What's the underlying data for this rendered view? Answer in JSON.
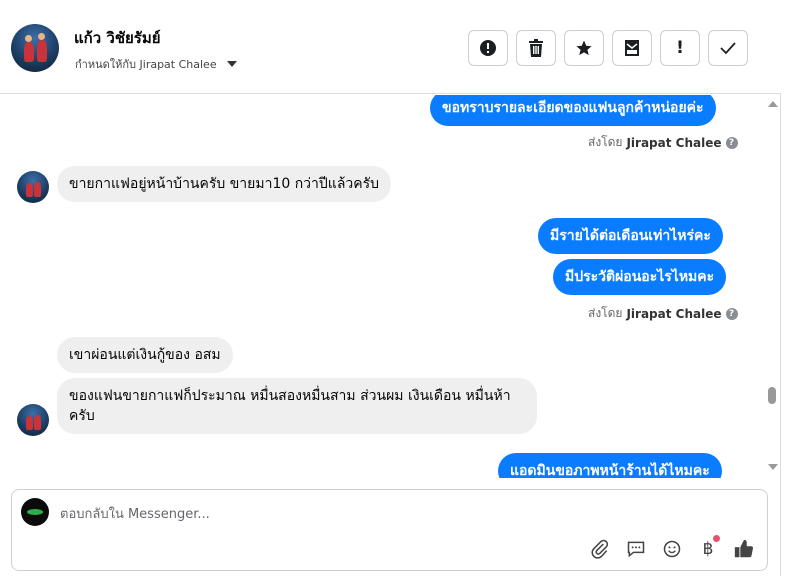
{
  "header": {
    "contact_name": "แก้ว วิชัยรัมย์",
    "assigned_to": "กำหนดให้กับ Jirapat Chalee"
  },
  "toolbar": {
    "buttons": [
      {
        "icon": "alert-circle-icon",
        "glyph": "❗"
      },
      {
        "icon": "trash-icon",
        "glyph": "🗑"
      },
      {
        "icon": "star-icon",
        "glyph": "★"
      },
      {
        "icon": "mark-unread-icon",
        "glyph": "✉"
      },
      {
        "icon": "exclamation-icon",
        "glyph": "!"
      },
      {
        "icon": "check-icon",
        "glyph": "✓"
      }
    ]
  },
  "messages": {
    "m1": "ขอทราบรายละเอียดของแฟนลูกค้าหน่อยค่ะ",
    "sent1_prefix": "ส่งโดย",
    "sent1_name": "Jirapat Chalee",
    "m2": "ขายกาแฟอยู่หน้าบ้านครับ  ขายมา10 กว่าปีแล้วครับ",
    "m3": "มีรายได้ต่อเดือนเท่าไหร่คะ",
    "m4": "มีประวัติผ่อนอะไรไหมคะ",
    "sent2_prefix": "ส่งโดย",
    "sent2_name": "Jirapat Chalee",
    "m5": "เขาผ่อนแต่เงินกู้ของ  อสม",
    "m6": "ของแฟนขายกาแฟก็ประมาณ หมื่นสองหมื่นสาม   ส่วนผม เงินเดือน หมื่นห้าครับ",
    "m7": "แอดมินขอภาพหน้าร้านได้ไหมคะ"
  },
  "composer": {
    "placeholder": "ตอบกลับใน Messenger..."
  },
  "colors": {
    "outgoing_bubble": "#0a7cff",
    "incoming_bubble": "#efefef"
  }
}
